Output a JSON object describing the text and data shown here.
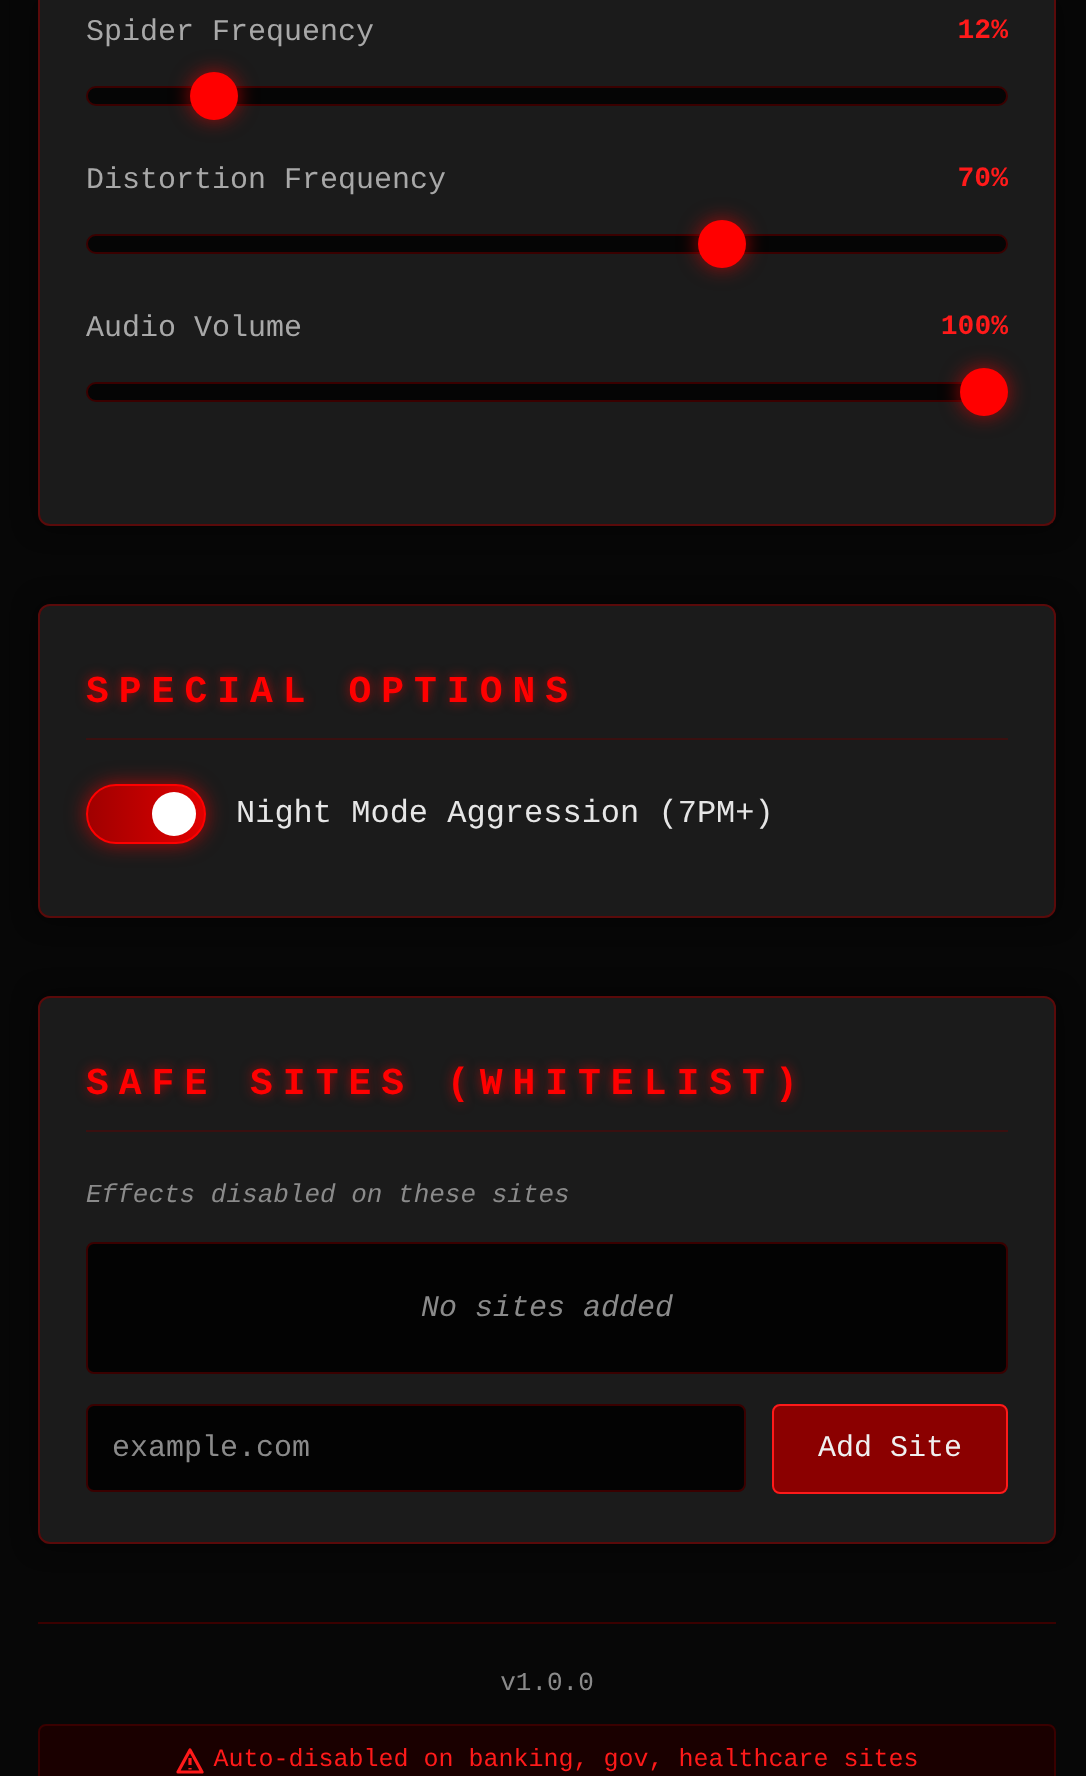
{
  "sliders": [
    {
      "label": "Spider Frequency",
      "reading": "12%",
      "level": 0.12
    },
    {
      "label": "Distortion Frequency",
      "reading": "70%",
      "level": 0.7
    },
    {
      "label": "Audio Volume",
      "reading": "100%",
      "level": 1.0
    }
  ],
  "special_options": {
    "title": "SPECIAL OPTIONS",
    "toggles": [
      {
        "label": "Night Mode Aggression (7PM+)",
        "on": true
      }
    ]
  },
  "safe_sites": {
    "title": "SAFE SITES (WHITELIST)",
    "hint": "Effects disabled on these sites",
    "empty_text": "No sites added",
    "input": {
      "placeholder": "example.com"
    },
    "button": "Add Site"
  },
  "footer": {
    "version": "v1.0.0",
    "warning": "Auto-disabled on banking, gov, healthcare sites"
  }
}
